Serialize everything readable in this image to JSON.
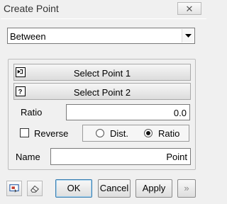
{
  "window": {
    "title": "Create Point",
    "close_glyph": "✕"
  },
  "method": {
    "selected": "Between"
  },
  "selection": {
    "point1_label": "Select Point 1",
    "point2_label": "Select Point 2"
  },
  "ratio": {
    "label": "Ratio",
    "value": "0.0"
  },
  "options": {
    "reverse_label": "Reverse",
    "reverse_checked": false,
    "mode_dist_label": "Dist.",
    "mode_ratio_label": "Ratio",
    "selected_mode": "Ratio"
  },
  "name": {
    "label": "Name",
    "value": "Point"
  },
  "footer": {
    "ok_label": "OK",
    "cancel_label": "Cancel",
    "apply_label": "Apply",
    "more_label": "»"
  },
  "icons": {
    "tool1": "screen-capture-icon",
    "tool2": "eraser-icon",
    "point1_icon": "arrow-into-box-icon",
    "point2_icon": "question-box-icon"
  }
}
